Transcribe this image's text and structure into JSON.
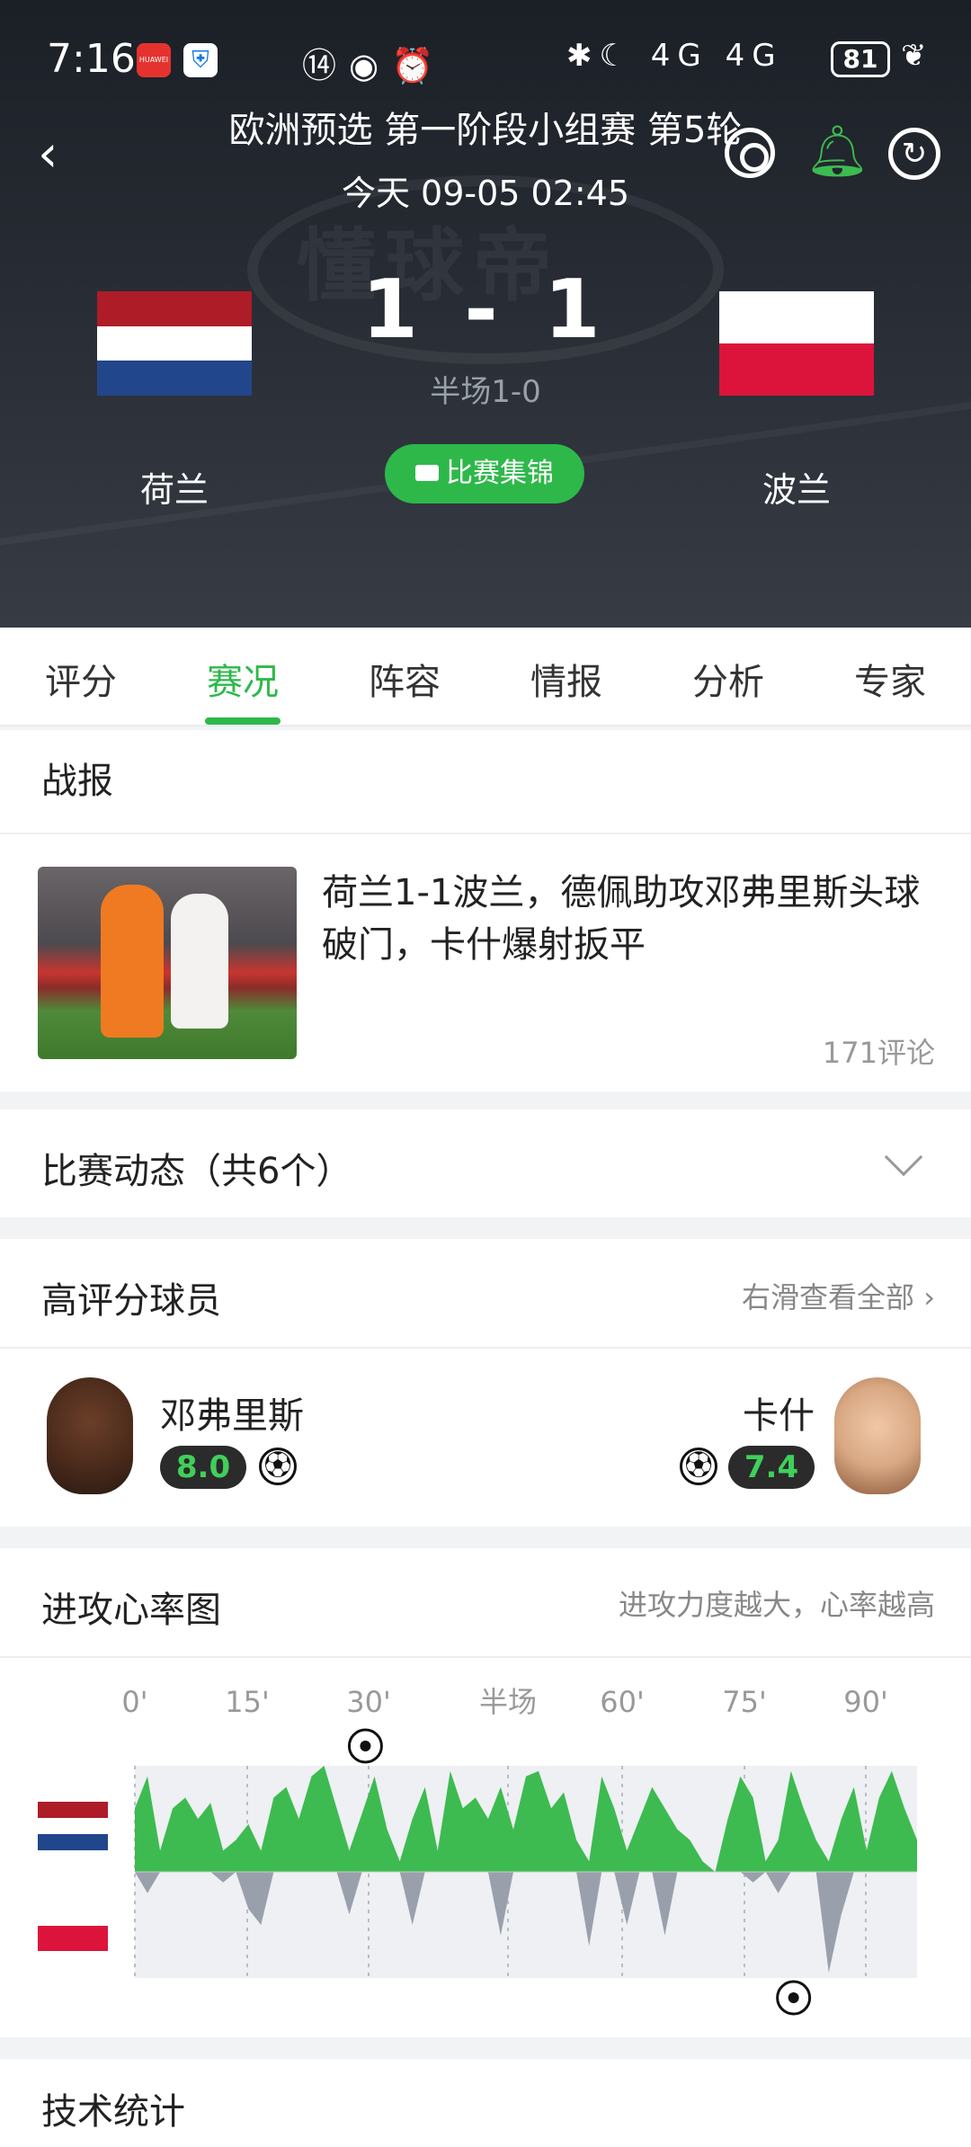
{
  "status_bar": {
    "time": "7:16",
    "app1_label": "HUAWEI",
    "mid_icons": "⑭◉⏰",
    "net": "✱☾ 4G 4G",
    "battery": "81"
  },
  "header": {
    "title": "欧洲预选 第一阶段小组赛 第5轮",
    "datetime": "今天 09-05 02:45",
    "watermark": "懂球帝",
    "home_team": "荷兰",
    "away_team": "波兰",
    "score": "1 - 1",
    "half_score": "半场1-0",
    "highlights_label": "比赛集锦",
    "home_flag_colors": [
      "#ae1c28",
      "#ffffff",
      "#21468b"
    ],
    "away_flag_colors": [
      "#ffffff",
      "#dc143c"
    ],
    "bell_color": "#3dbb50"
  },
  "tabs": [
    {
      "label": "评分"
    },
    {
      "label": "赛况"
    },
    {
      "label": "阵容"
    },
    {
      "label": "情报"
    },
    {
      "label": "分析"
    },
    {
      "label": "专家"
    }
  ],
  "active_tab": "赛况",
  "accent_color": "#2eb84a",
  "report": {
    "section_title": "战报",
    "headline": "荷兰1-1波兰，德佩助攻邓弗里斯头球破门，卡什爆射扳平",
    "comments": "171评论"
  },
  "events": {
    "title": "比赛动态（共6个）"
  },
  "top_players": {
    "title": "高评分球员",
    "more": "右滑查看全部",
    "left": {
      "name": "邓弗里斯",
      "rating": "8.0"
    },
    "right": {
      "name": "卡什",
      "rating": "7.4"
    }
  },
  "heart_rate": {
    "title": "进攻心率图",
    "note": "进攻力度越大，心率越高",
    "axis_labels": [
      "0'",
      "15'",
      "30'",
      "半场",
      "60'",
      "75'",
      "90'"
    ]
  },
  "tech_stats": {
    "title": "技术统计"
  },
  "chart_data": {
    "type": "area",
    "x_ticks": [
      "0'",
      "15'",
      "30'",
      "半场",
      "60'",
      "75'",
      "90'"
    ],
    "series": [
      {
        "color": "#3dbb50",
        "values": [
          0.6,
          0.9,
          0.2,
          0.6,
          0.7,
          0.5,
          0.65,
          0.2,
          0.3,
          0.45,
          0.2,
          0.7,
          0.8,
          0.5,
          0.9,
          1.0,
          0.6,
          0.2,
          0.55,
          0.9,
          0.4,
          0.1,
          0.5,
          0.8,
          0.2,
          0.95,
          0.6,
          0.7,
          0.5,
          0.8,
          0.4,
          0.9,
          0.95,
          0.6,
          0.75,
          0.3,
          0.1,
          0.9,
          0.6,
          0.2,
          0.5,
          0.8,
          0.6,
          0.4,
          0.3,
          0.1,
          0.0,
          0.5,
          0.9,
          0.7,
          0.1,
          0.3,
          0.95,
          0.6,
          0.3,
          0.1,
          0.5,
          0.8,
          0.2,
          0.7,
          0.95,
          0.6,
          0.3
        ]
      },
      {
        "color": "#9aa0ab",
        "values": [
          0.0,
          0.2,
          0.0,
          0.0,
          0.0,
          0.0,
          0.0,
          0.1,
          0.0,
          0.35,
          0.5,
          0.0,
          0.0,
          0.0,
          0.0,
          0.0,
          0.0,
          0.4,
          0.0,
          0.0,
          0.0,
          0.0,
          0.5,
          0.0,
          0.0,
          0.0,
          0.0,
          0.0,
          0.0,
          0.6,
          0.0,
          0.0,
          0.0,
          0.0,
          0.0,
          0.0,
          0.7,
          0.0,
          0.0,
          0.5,
          0.0,
          0.0,
          0.6,
          0.0,
          0.0,
          0.0,
          0.0,
          0.0,
          0.0,
          0.1,
          0.0,
          0.2,
          0.0,
          0.0,
          0.0,
          0.95,
          0.4,
          0.0,
          0.0,
          0.0,
          0.0,
          0.0,
          0.0
        ]
      }
    ],
    "goal_minutes": [
      28,
      80
    ]
  }
}
